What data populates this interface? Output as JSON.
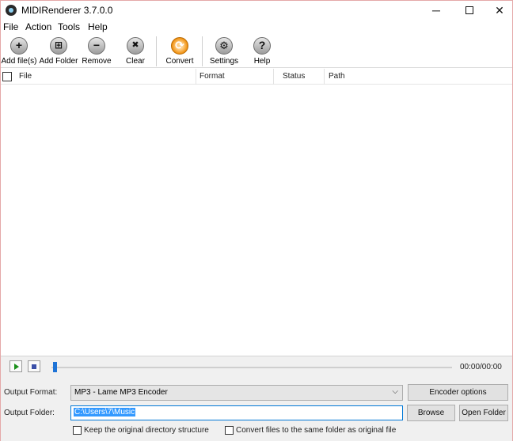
{
  "window": {
    "title": "MIDIRenderer 3.7.0.0",
    "controls": {
      "minimize": "─",
      "close": "✕"
    }
  },
  "menu": [
    "File",
    "Action",
    "Tools",
    "Help"
  ],
  "toolbar": {
    "add_files": "Add file(s)",
    "add_folder": "Add Folder",
    "remove": "Remove",
    "clear": "Clear",
    "convert": "Convert",
    "settings": "Settings",
    "help": "Help",
    "icons": {
      "add_files": "+",
      "add_folder": "⊞",
      "remove": "−",
      "clear": "✖",
      "convert": "⟳",
      "settings": "⚙",
      "help": "?"
    }
  },
  "list": {
    "columns": [
      "File",
      "Format",
      "Status",
      "Path"
    ],
    "rows": []
  },
  "player": {
    "time": "00:00/00:00",
    "position": 0
  },
  "options": {
    "output_format_label": "Output Format:",
    "output_format_value": "MP3 - Lame MP3 Encoder",
    "encoder_options": "Encoder options",
    "output_folder_label": "Output Folder:",
    "output_folder_value": "C:\\Users\\7\\Music",
    "browse": "Browse",
    "open_folder": "Open Folder",
    "keep_structure": "Keep the original directory structure",
    "same_folder": "Convert files to the same folder as original file",
    "keep_structure_checked": false,
    "same_folder_checked": false
  }
}
